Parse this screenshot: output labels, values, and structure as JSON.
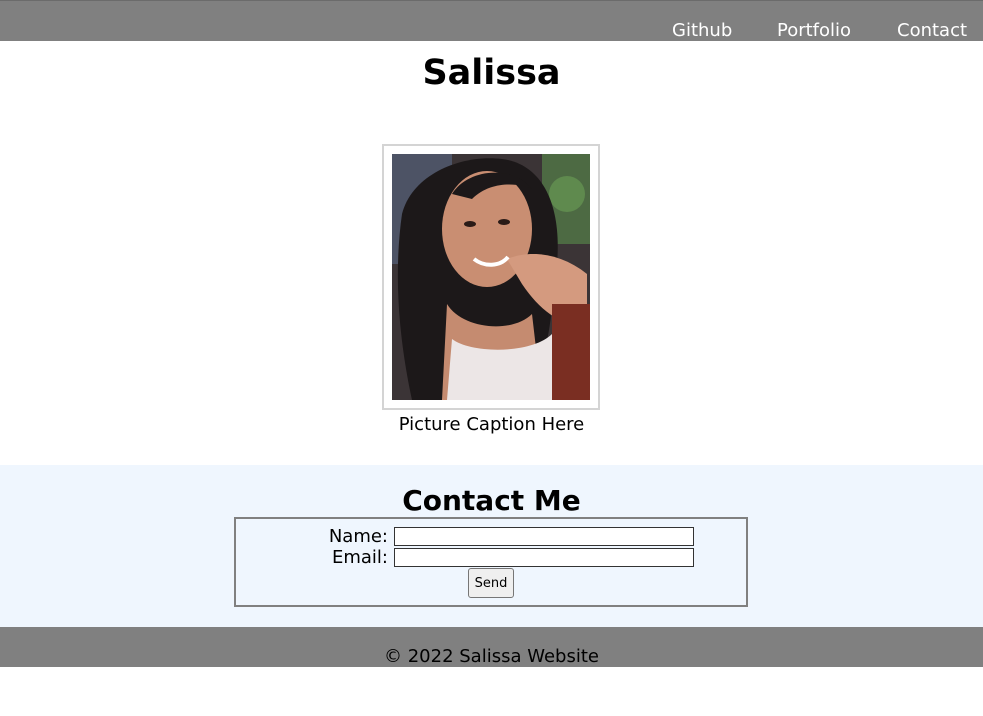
{
  "nav": {
    "links": [
      {
        "label": "Github"
      },
      {
        "label": "Portfolio"
      },
      {
        "label": "Contact"
      }
    ]
  },
  "header": {
    "title": "Salissa"
  },
  "profile": {
    "caption": "Picture Caption Here"
  },
  "contact": {
    "title": "Contact Me",
    "name_label": "Name:",
    "name_value": "",
    "email_label": "Email:",
    "email_value": "",
    "send_label": "Send"
  },
  "footer": {
    "text": "© 2022 Salissa Website"
  },
  "colors": {
    "nav_background": "#808080",
    "contact_background": "#eff6fe",
    "footer_background": "#808080"
  }
}
